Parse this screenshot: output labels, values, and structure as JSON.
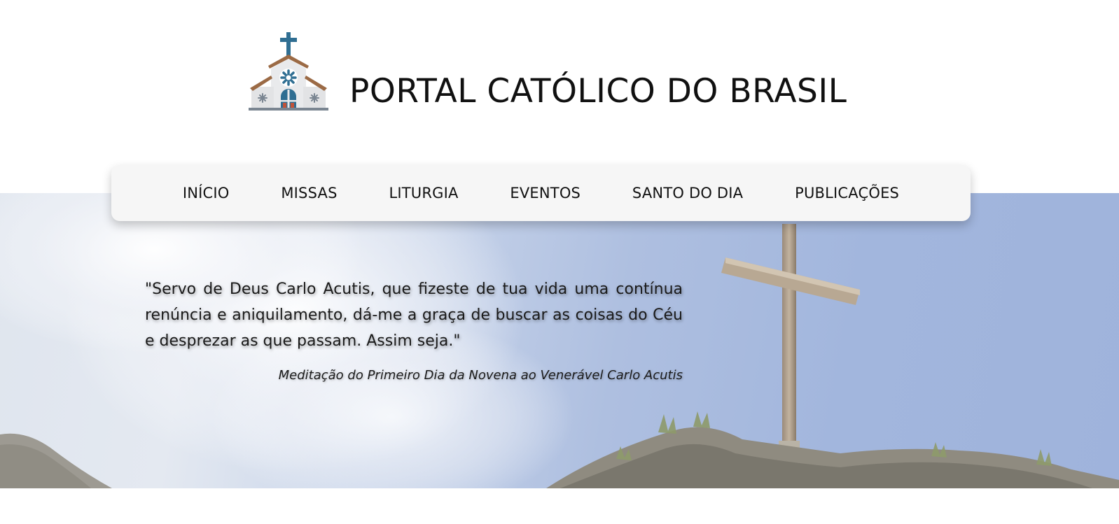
{
  "header": {
    "logo_icon": "church-icon",
    "title": "PORTAL CATÓLICO DO BRASIL"
  },
  "nav": {
    "items": [
      {
        "label": "INÍCIO"
      },
      {
        "label": "MISSAS"
      },
      {
        "label": "LITURGIA"
      },
      {
        "label": "EVENTOS"
      },
      {
        "label": "SANTO DO DIA"
      },
      {
        "label": "PUBLICAÇÕES"
      }
    ]
  },
  "hero": {
    "background_icon": "cross-on-mountain-icon",
    "quote": "\"Servo de Deus Carlo Acutis, que fizeste de tua vida uma contínua renúncia e aniquilamento, dá-me a graça de buscar as coisas do Céu e desprezar as que passam. Assim seja.\"",
    "source": "Meditação do Primeiro Dia da Novena ao Venerável Carlo Acutis"
  },
  "colors": {
    "nav_background": "#f6f6f6",
    "sky": "#a2b6dd",
    "church_roof": "#9b6a45",
    "church_blue": "#2f6e92"
  }
}
